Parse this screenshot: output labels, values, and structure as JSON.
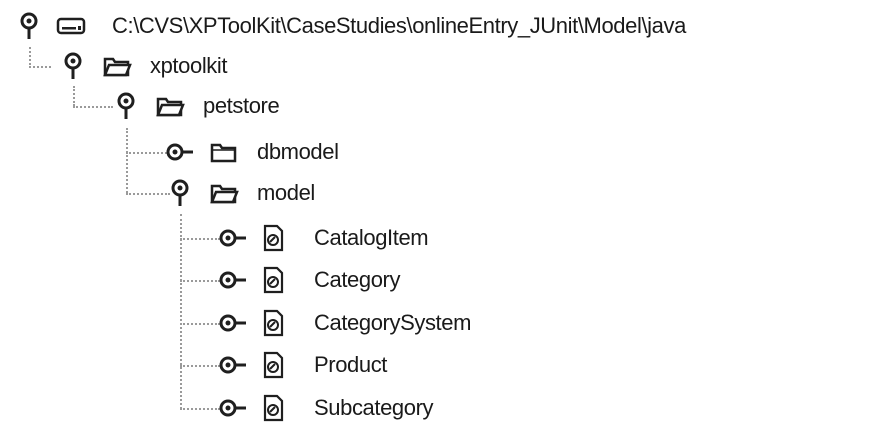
{
  "tree": {
    "root": {
      "label": "C:\\CVS\\XPToolKit\\CaseStudies\\onlineEntry_JUnit\\Model\\java",
      "icon": "drive-icon",
      "expanded": true
    },
    "nodes": [
      {
        "id": "xptoolkit",
        "label": "xptoolkit",
        "icon": "folder-open-icon",
        "expanded": true
      },
      {
        "id": "petstore",
        "label": "petstore",
        "icon": "folder-open-icon",
        "expanded": true
      },
      {
        "id": "dbmodel",
        "label": "dbmodel",
        "icon": "folder-closed-icon",
        "expanded": false
      },
      {
        "id": "model",
        "label": "model",
        "icon": "folder-open-icon",
        "expanded": true
      },
      {
        "id": "catalogitem",
        "label": "CatalogItem",
        "icon": "java-file-icon",
        "expanded": false
      },
      {
        "id": "category",
        "label": "Category",
        "icon": "java-file-icon",
        "expanded": false
      },
      {
        "id": "categorysystem",
        "label": "CategorySystem",
        "icon": "java-file-icon",
        "expanded": false
      },
      {
        "id": "product",
        "label": "Product",
        "icon": "java-file-icon",
        "expanded": false
      },
      {
        "id": "subcategory",
        "label": "Subcategory",
        "icon": "java-file-icon",
        "expanded": false
      }
    ]
  },
  "colors": {
    "text": "#1a1a1a",
    "icon_stroke": "#1f1f1f",
    "folder_fill": "#ffffff",
    "guide": "#9a9a9a"
  }
}
